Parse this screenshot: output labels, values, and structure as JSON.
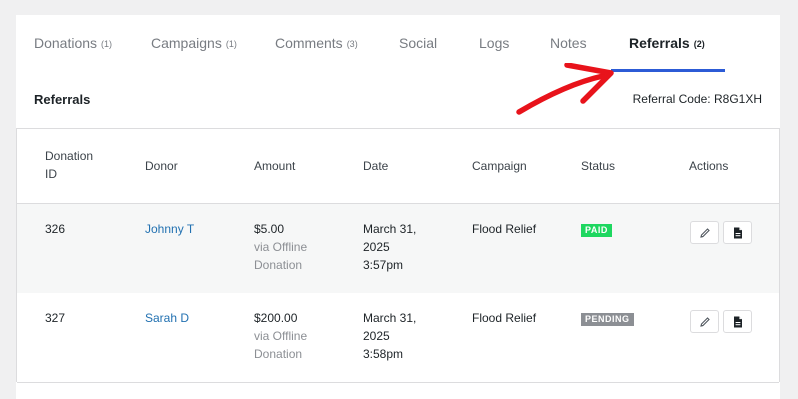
{
  "tabs": [
    {
      "label": "Donations",
      "count": "(1)"
    },
    {
      "label": "Campaigns",
      "count": "(1)"
    },
    {
      "label": "Comments",
      "count": "(3)"
    },
    {
      "label": "Social",
      "count": ""
    },
    {
      "label": "Logs",
      "count": ""
    },
    {
      "label": "Notes",
      "count": ""
    },
    {
      "label": "Referrals",
      "count": "(2)"
    }
  ],
  "active_tab": "Referrals",
  "section": {
    "title": "Referrals",
    "referral_code": "Referral Code: R8G1XH"
  },
  "table": {
    "headers": {
      "id_line1": "Donation",
      "id_line2": "ID",
      "donor": "Donor",
      "amount": "Amount",
      "date": "Date",
      "campaign": "Campaign",
      "status": "Status",
      "actions": "Actions"
    },
    "rows": [
      {
        "id": "326",
        "donor": "Johnny T",
        "amount": "$5.00",
        "via1": "via Offline",
        "via2": "Donation",
        "date1": "March 31,",
        "date2": "2025",
        "time": "3:57pm",
        "campaign": "Flood Relief",
        "status": "PAID",
        "status_color": "#1ed760"
      },
      {
        "id": "327",
        "donor": "Sarah D",
        "amount": "$200.00",
        "via1": "via Offline",
        "via2": "Donation",
        "date1": "March 31,",
        "date2": "2025",
        "time": "3:58pm",
        "campaign": "Flood Relief",
        "status": "PENDING",
        "status_color": "#8c8f94"
      }
    ]
  },
  "colors": {
    "accent": "#2c5bd6",
    "link": "#2271b1",
    "annotation_arrow": "#e8131b"
  }
}
